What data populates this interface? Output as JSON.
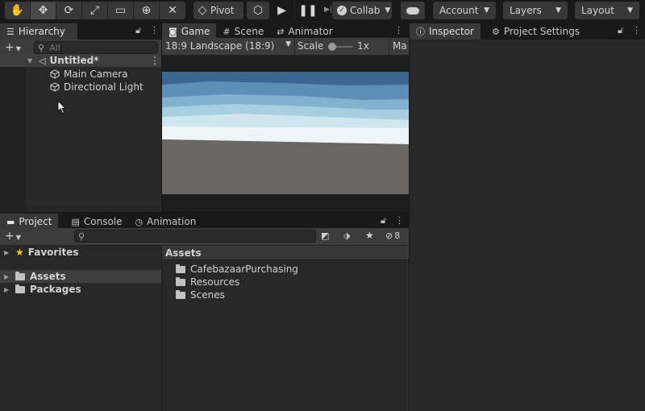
{
  "toolbar": {
    "pivot_label": "Pivot",
    "collab_label": "Collab",
    "account_label": "Account",
    "layers_label": "Layers",
    "layout_label": "Layout"
  },
  "hierarchy": {
    "tab_label": "Hierarchy",
    "search_placeholder": "All",
    "scene_name": "Untitled*",
    "items": [
      "Main Camera",
      "Directional Light"
    ]
  },
  "game": {
    "tabs": [
      "Game",
      "Scene",
      "Animator"
    ],
    "aspect_label": "18:9 Landscape (18:9)",
    "scale_label": "Scale",
    "scale_value": "1x",
    "maximize_label": "Ma"
  },
  "inspector": {
    "tabs": [
      "Inspector",
      "Project Settings"
    ]
  },
  "project": {
    "tabs": [
      "Project",
      "Console",
      "Animation"
    ],
    "badge_count": "8",
    "left_tree": [
      "Favorites",
      "Assets",
      "Packages"
    ],
    "assets_header": "Assets",
    "assets_items": [
      "CafebazaarPurchasing",
      "Resources",
      "Scenes"
    ]
  }
}
